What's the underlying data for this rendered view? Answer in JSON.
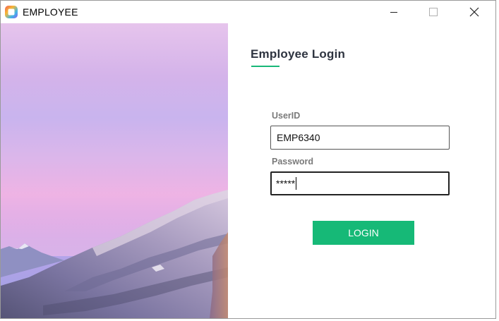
{
  "window": {
    "title": "EMPLOYEE",
    "icon": "app-logo-icon",
    "controls": {
      "minimize": "minimize-icon",
      "maximize": "maximize-icon",
      "close": "close-icon"
    }
  },
  "hero": {
    "image": "mountain-landscape-image"
  },
  "login": {
    "heading": "Employee Login",
    "userid_label": "UserID",
    "userid_value": "EMP6340",
    "password_label": "Password",
    "password_value": "*****",
    "button_label": "LOGIN"
  },
  "colors": {
    "accent": "#16b977",
    "heading": "#2e3440",
    "label": "#7a7a7a"
  }
}
